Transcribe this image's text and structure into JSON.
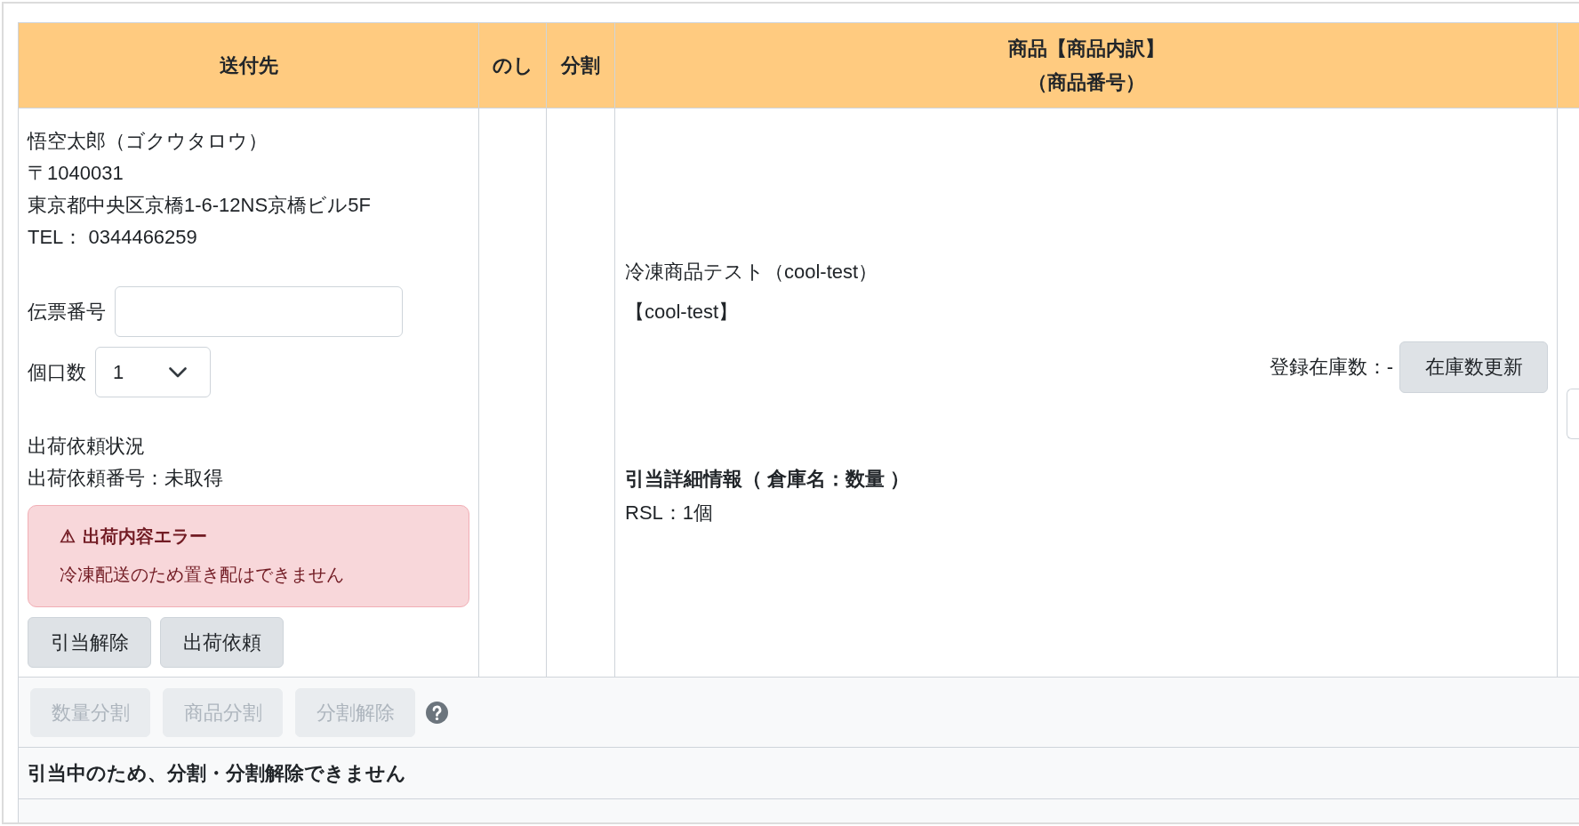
{
  "table": {
    "columns": [
      {
        "lines": [
          "送付先"
        ]
      },
      {
        "lines": [
          "のし"
        ]
      },
      {
        "lines": [
          "分割"
        ]
      },
      {
        "lines": [
          "商品【商品内訳】",
          "（商品番号）"
        ]
      }
    ],
    "rows": [
      {
        "recipient": {
          "name": "悟空太郎（ゴクウタロウ）",
          "postal_code": "〒1040031",
          "address": "東京都中央区京橋1-6-12NS京橋ビル5F",
          "phone": "TEL： 0344466259"
        },
        "tracking_number": {
          "label": "伝票番号"
        },
        "parcel_count": {
          "label": "個口数",
          "value": "1"
        },
        "shipment_status": {
          "heading": "出荷依頼状況",
          "request_number": "出荷依頼番号：未取得"
        },
        "alert": {
          "icon": "⚠",
          "title": "出荷内容エラー",
          "message": "冷凍配送のため置き配はできません"
        },
        "actions": [
          {
            "label": "引当解除",
            "disabled": false
          },
          {
            "label": "出荷依頼",
            "disabled": false
          }
        ],
        "product": {
          "name": "冷凍商品テスト（cool-test）",
          "code": "【cool-test】",
          "stock_label": "登録在庫数：-",
          "stock_button": "在庫数更新",
          "allocation_heading": "引当詳細情報（ 倉庫名：数量 ）",
          "allocations": [
            "RSL：1個"
          ]
        }
      }
    ],
    "footer": {
      "split_buttons": [
        {
          "label": "数量分割",
          "disabled": true
        },
        {
          "label": "商品分割",
          "disabled": true
        },
        {
          "label": "分割解除",
          "disabled": true
        }
      ],
      "notice": "引当中のため、分割・分割解除できません"
    }
  }
}
